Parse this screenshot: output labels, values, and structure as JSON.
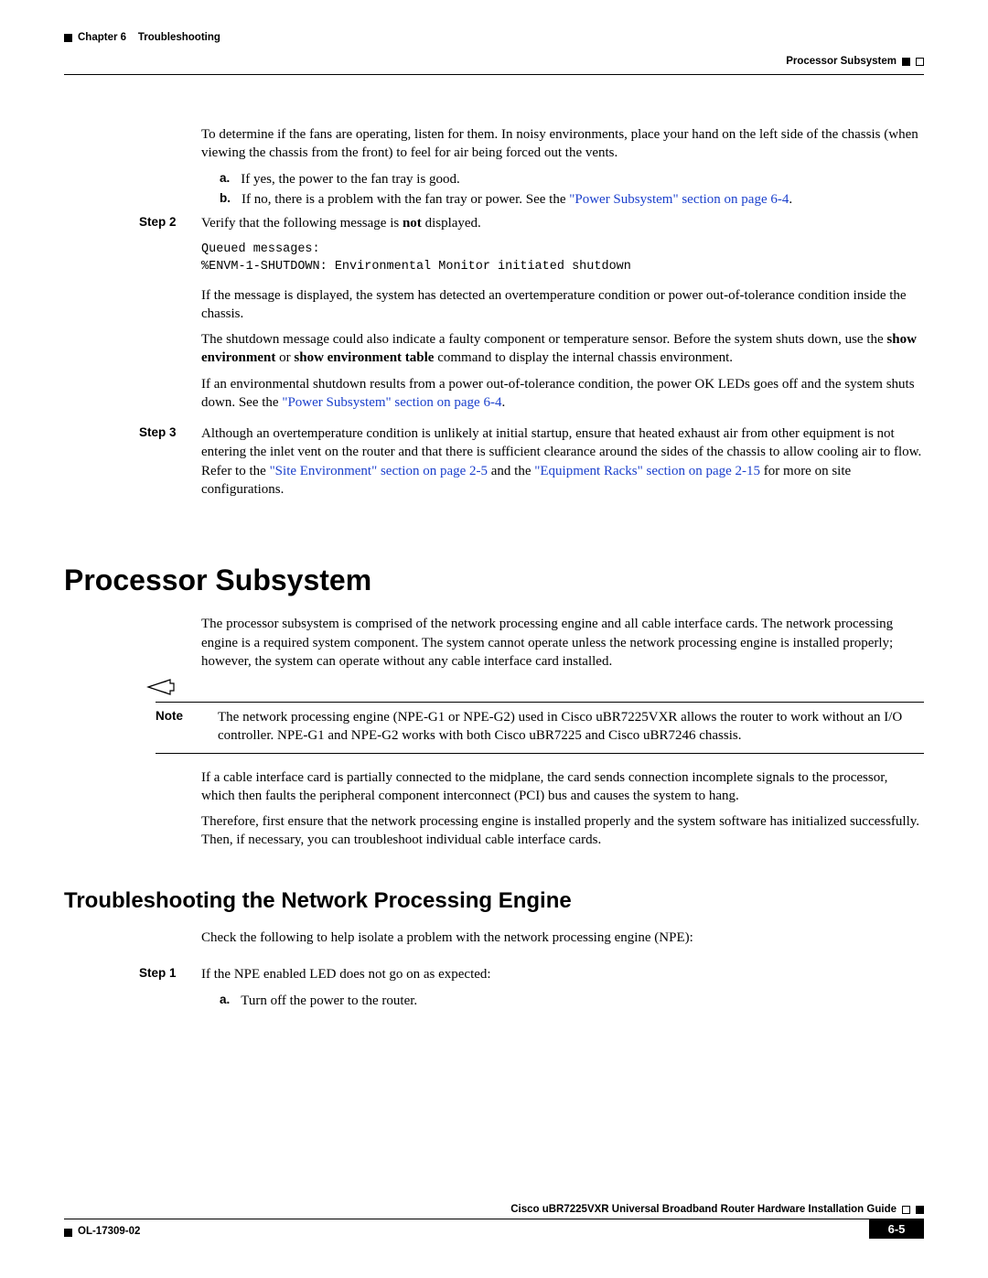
{
  "header": {
    "chapter_prefix": "Chapter 6",
    "chapter_title": "Troubleshooting",
    "section": "Processor Subsystem"
  },
  "intro": {
    "p1": "To determine if the fans are operating, listen for them. In noisy environments, place your hand on the left side of the chassis (when viewing the chassis from the front) to feel for air being forced out the vents.",
    "a_marker": "a.",
    "a_text": "If yes, the power to the fan tray is good.",
    "b_marker": "b.",
    "b_text_pre": "If no, there is a problem with the fan tray or power. See the ",
    "b_link": "\"Power Subsystem\" section on page 6-4",
    "b_text_post": "."
  },
  "step2": {
    "label": "Step 2",
    "line1_pre": "Verify that the following message is ",
    "line1_bold": "not",
    "line1_post": " displayed.",
    "code": "Queued messages:\n%ENVM-1-SHUTDOWN: Environmental Monitor initiated shutdown",
    "p2": "If the message is displayed, the system has detected an overtemperature condition or power out-of-tolerance condition inside the chassis.",
    "p3_pre": "The shutdown message could also indicate a faulty component or temperature sensor. Before the system shuts down, use the ",
    "p3_b1": "show environment",
    "p3_mid": " or ",
    "p3_b2": "show environment table",
    "p3_post": " command to display the internal chassis environment.",
    "p4_pre": "If an environmental shutdown results from a power out-of-tolerance condition, the power OK LEDs goes off and the system shuts down. See the ",
    "p4_link": "\"Power Subsystem\" section on page 6-4",
    "p4_post": "."
  },
  "step3": {
    "label": "Step 3",
    "p_pre": "Although an overtemperature condition is unlikely at initial startup, ensure that heated exhaust air from other equipment is not entering the inlet vent on the router and that there is sufficient clearance around the sides of the chassis to allow cooling air to flow. Refer to the ",
    "link1": "\"Site Environment\" section on page 2-5",
    "mid": " and the ",
    "link2": "\"Equipment Racks\" section on page 2-15",
    "post": " for more on site configurations."
  },
  "processor": {
    "h1": "Processor Subsystem",
    "p1": "The processor subsystem is comprised of the network processing engine and all cable interface cards. The network processing engine is a required system component. The system cannot operate unless the network processing engine is installed properly; however, the system can operate without any cable interface card installed.",
    "note_label": "Note",
    "note_body": "The network processing engine (NPE-G1 or NPE-G2) used in Cisco uBR7225VXR allows the router to work without an I/O controller. NPE-G1 and NPE-G2 works with both Cisco uBR7225 and Cisco uBR7246 chassis.",
    "p2": "If a cable interface card is partially connected to the midplane, the card sends connection incomplete signals to the processor, which then faults the peripheral component interconnect (PCI) bus and causes the system to hang.",
    "p3": "Therefore, first ensure that the network processing engine is installed properly and the system software has initialized successfully. Then, if necessary, you can troubleshoot individual cable interface cards."
  },
  "troubleshoot": {
    "h2": "Troubleshooting the Network Processing Engine",
    "intro": "Check the following to help isolate a problem with the network processing engine (NPE):",
    "step1_label": "Step 1",
    "step1_text": "If the NPE enabled LED does not go on as expected:",
    "a_marker": "a.",
    "a_text": "Turn off the power to the router."
  },
  "footer": {
    "guide": "Cisco uBR7225VXR Universal Broadband Router Hardware Installation Guide",
    "doc": "OL-17309-02",
    "page": "6-5"
  }
}
